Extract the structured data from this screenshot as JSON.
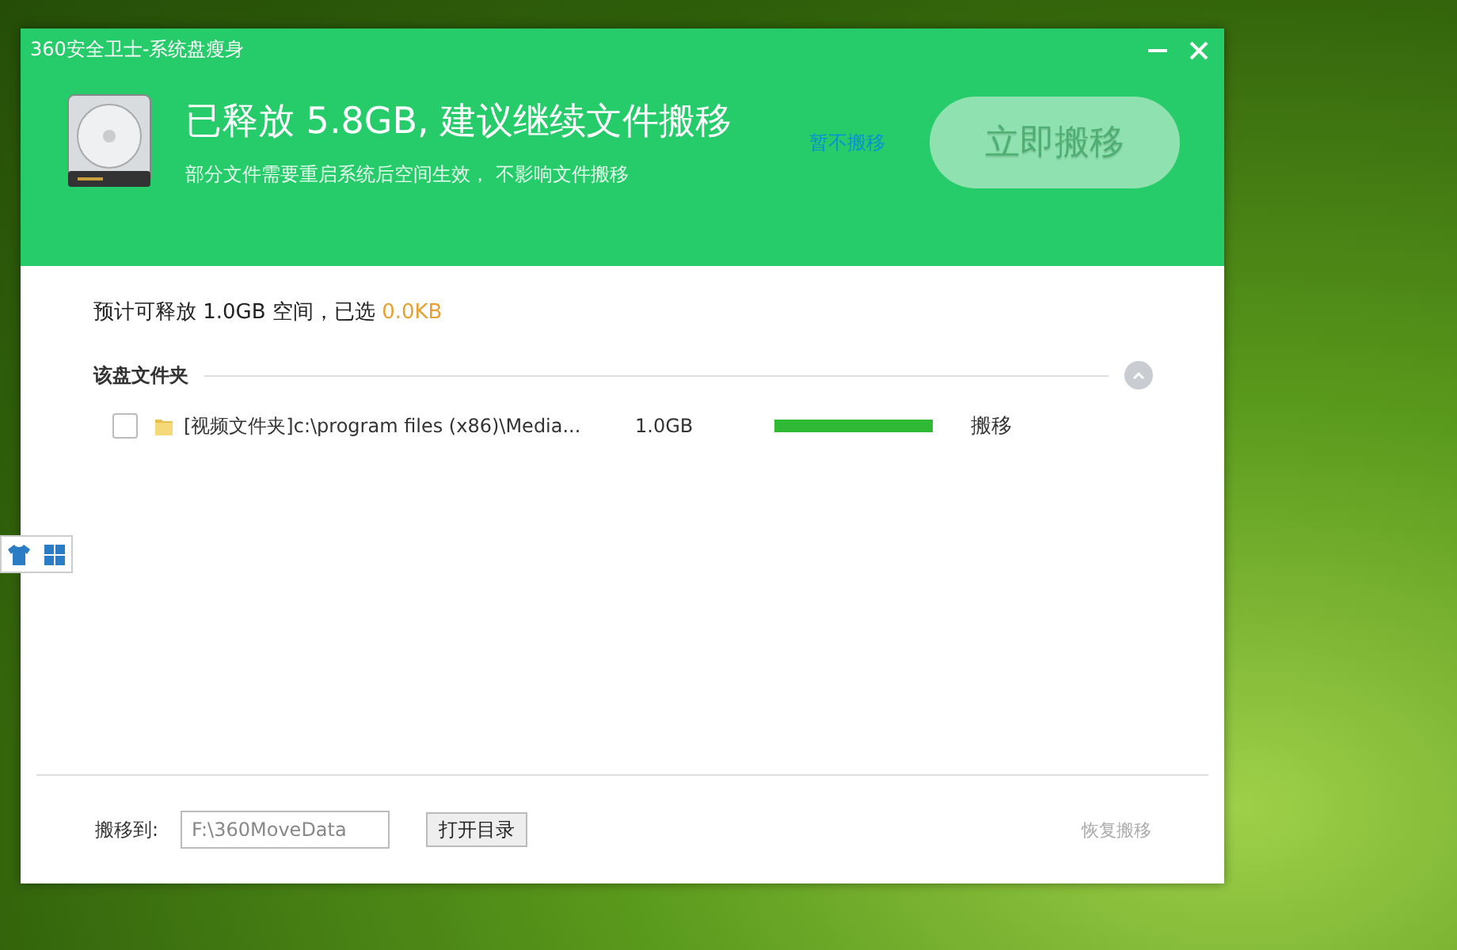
{
  "window": {
    "title": "360安全卫士-系统盘瘦身"
  },
  "header": {
    "headline": "已释放 5.8GB, 建议继续文件搬移",
    "subtext": "部分文件需要重启系统后空间生效， 不影响文件搬移",
    "skip_link": "暂不搬移",
    "move_button": {
      "label": "立即搬移",
      "disabled": true
    }
  },
  "summary": {
    "text": "预计可释放 1.0GB 空间，已选",
    "selected_size": "0.0KB"
  },
  "section": {
    "title": "该盘文件夹",
    "expanded": true,
    "rows": [
      {
        "name": "[视频文件夹]c:\\program files (x86)\\Media...",
        "size": "1.0GB",
        "level": 1,
        "action": "搬移",
        "checked": false
      }
    ]
  },
  "footer": {
    "label": "搬移到:",
    "path": "F:\\360MoveData",
    "open_button": "打开目录",
    "restore_link": "恢复搬移"
  }
}
